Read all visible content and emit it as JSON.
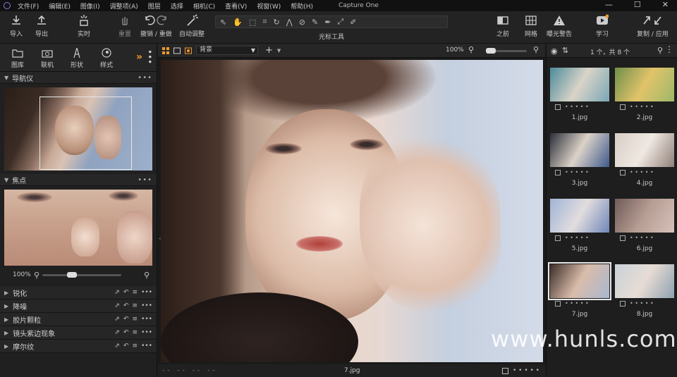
{
  "menubar": {
    "app_title": "Capture One",
    "items": [
      "文件(F)",
      "编辑(E)",
      "图像(I)",
      "调整项(A)",
      "图层",
      "选择",
      "相机(C)",
      "查看(V)",
      "视窗(W)",
      "帮助(H)"
    ],
    "window_controls": [
      "—",
      "☐",
      "✕"
    ]
  },
  "toolbar": {
    "import": "导入",
    "export": "导出",
    "live": "实时",
    "reset": "重置",
    "undo_redo": "撤销 / 重做",
    "auto_adjust": "自动调整",
    "cursor_tools": "光标工具",
    "before": "之前",
    "grid": "网格",
    "exposure_warning": "曝光警告",
    "learn": "学习",
    "copy_apply": "复制 / 应用"
  },
  "left_panel": {
    "tabs": [
      "图库",
      "联机",
      "形状",
      "样式"
    ],
    "navigator_title": "导航仪",
    "focus_title": "焦点",
    "focus_zoom": "100%",
    "tools": [
      "锐化",
      "降噪",
      "胶片颗粒",
      "镜头紫边现象",
      "摩尔纹"
    ]
  },
  "viewer": {
    "layer_select": "背景",
    "zoom": "100%",
    "filename": "7.jpg",
    "dashes": "-- -- -- --",
    "rating_dots": "• • • • •"
  },
  "browser": {
    "count": "1 个，共 8 个",
    "thumbs": [
      {
        "name": "1.jpg",
        "colors": [
          "#4c8a9a",
          "#d9d4c8",
          "#7aa7b5"
        ]
      },
      {
        "name": "2.jpg",
        "colors": [
          "#6f8f4a",
          "#e1c36a",
          "#9db86a"
        ]
      },
      {
        "name": "3.jpg",
        "colors": [
          "#2a2f3a",
          "#dcd2c8",
          "#3f5a8c"
        ]
      },
      {
        "name": "4.jpg",
        "colors": [
          "#d8cfc6",
          "#efe8e2",
          "#8f8078"
        ]
      },
      {
        "name": "5.jpg",
        "colors": [
          "#9fb3d6",
          "#e2ddde",
          "#6f86b8"
        ]
      },
      {
        "name": "6.jpg",
        "colors": [
          "#6f5b58",
          "#b79d93",
          "#d6c2bb"
        ]
      },
      {
        "name": "7.jpg",
        "colors": [
          "#3b2c27",
          "#d9bcaa",
          "#a9b8cf"
        ],
        "selected": true
      },
      {
        "name": "8.jpg",
        "colors": [
          "#c9d2d8",
          "#e7dcd5",
          "#8fa1b0"
        ]
      }
    ],
    "rating_dots": "• • • • •"
  },
  "watermark": "www.hunls.com"
}
